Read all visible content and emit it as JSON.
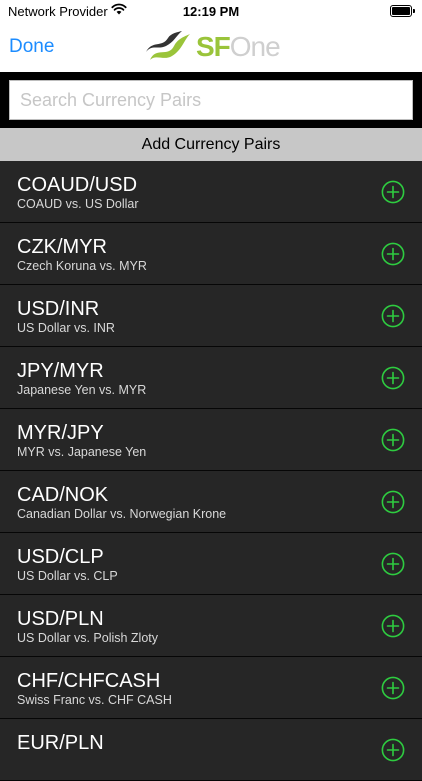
{
  "status_bar": {
    "carrier": "Network Provider",
    "time": "12:19 PM"
  },
  "nav": {
    "done_label": "Done",
    "logo_sf": "SF",
    "logo_one": "One"
  },
  "search": {
    "placeholder": "Search Currency Pairs",
    "value": ""
  },
  "section_title": "Add Currency Pairs",
  "colors": {
    "accent": "#1c8cff",
    "add_icon": "#2ecc40",
    "row_bg": "#262626",
    "logo_green": "#9ac43a"
  },
  "pairs": [
    {
      "pair": "COAUD/USD",
      "desc": "COAUD vs. US Dollar"
    },
    {
      "pair": "CZK/MYR",
      "desc": "Czech Koruna vs. MYR"
    },
    {
      "pair": "USD/INR",
      "desc": "US Dollar vs. INR"
    },
    {
      "pair": "JPY/MYR",
      "desc": "Japanese Yen vs. MYR"
    },
    {
      "pair": "MYR/JPY",
      "desc": "MYR vs. Japanese Yen"
    },
    {
      "pair": "CAD/NOK",
      "desc": "Canadian Dollar vs. Norwegian Krone"
    },
    {
      "pair": "USD/CLP",
      "desc": "US Dollar vs. CLP"
    },
    {
      "pair": "USD/PLN",
      "desc": "US Dollar vs. Polish Zloty"
    },
    {
      "pair": "CHF/CHFCASH",
      "desc": "Swiss Franc vs. CHF CASH"
    },
    {
      "pair": "EUR/PLN",
      "desc": ""
    }
  ]
}
